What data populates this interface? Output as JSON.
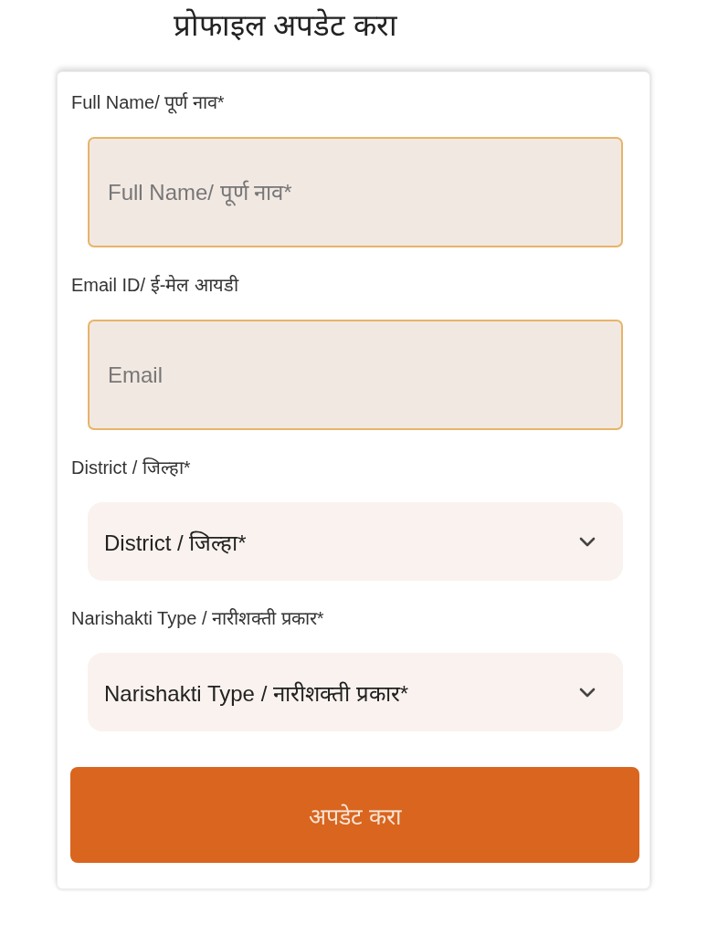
{
  "page": {
    "title": "प्रोफाइल अपडेट करा"
  },
  "fields": [
    {
      "kind": "text",
      "label": "Full Name/ पूर्ण नाव*",
      "placeholder": "Full Name/ पूर्ण नाव*"
    },
    {
      "kind": "text",
      "label": "Email ID/ ई-मेल आयडी",
      "placeholder": "Email"
    },
    {
      "kind": "select",
      "label": "District / जिल्हा*",
      "value": "District / जिल्हा*"
    },
    {
      "kind": "select",
      "label": "Narishakti Type / नारीशक्ती प्रकार*",
      "value": "Narishakti Type / नारीशक्ती प्रकार*"
    }
  ],
  "submit": {
    "label": "अपडेट करा"
  }
}
